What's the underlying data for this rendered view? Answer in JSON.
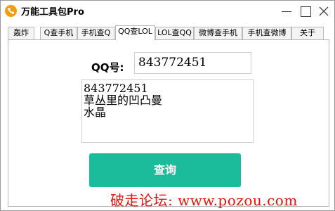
{
  "window": {
    "title": "万能工具包Pro"
  },
  "tabs": [
    {
      "label": "轰炸"
    },
    {
      "label": "Q查手机"
    },
    {
      "label": "手机查Q"
    },
    {
      "label": "QQ查LOL"
    },
    {
      "label": "LOL查QQ"
    },
    {
      "label": "微博查手机"
    },
    {
      "label": "手机查微博"
    },
    {
      "label": "关于"
    }
  ],
  "active_tab": "QQ查LOL",
  "form": {
    "qq_label": "QQ号:",
    "qq_value": "843772451",
    "result_text": "843772451\n草丛里的凹凸曼\n水晶",
    "query_button": "查询"
  },
  "watermark": "破走论坛: www.pozou.com",
  "colors": {
    "accent": "#1abc9c",
    "watermark": "#e81111",
    "icon": "#f39c12"
  }
}
